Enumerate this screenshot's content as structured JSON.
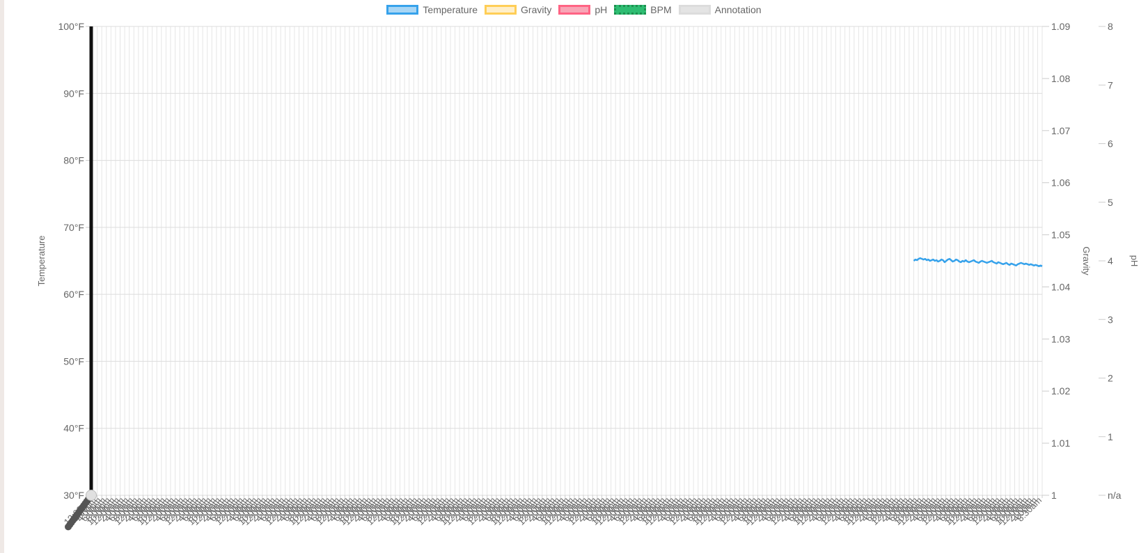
{
  "chart_data": {
    "type": "line",
    "legend": {
      "position": "top",
      "entries": [
        {
          "label": "Temperature",
          "fill": "#a8d6f5",
          "border": "#36a2eb",
          "style": "solid"
        },
        {
          "label": "Gravity",
          "fill": "#ffefc9",
          "border": "#ffce56",
          "style": "solid"
        },
        {
          "label": "pH",
          "fill": "#f8a5b6",
          "border": "#ff6384",
          "style": "solid"
        },
        {
          "label": "BPM",
          "fill": "#2ebd72",
          "border": "#1e8f50",
          "style": "dotted"
        },
        {
          "label": "Annotation",
          "fill": "#e4e4e4",
          "border": "#dcdcdc",
          "style": "solid"
        }
      ]
    },
    "axes": {
      "temperature": {
        "label": "Temperature",
        "position": "left",
        "ticks": [
          "100°F",
          "90°F",
          "80°F",
          "70°F",
          "60°F",
          "50°F",
          "40°F",
          "30°F"
        ],
        "range": [
          30,
          100
        ]
      },
      "gravity": {
        "label": "Gravity",
        "position": "right",
        "ticks": [
          "1.09",
          "1.08",
          "1.07",
          "1.06",
          "1.05",
          "1.04",
          "1.03",
          "1.02",
          "1.01",
          "1"
        ],
        "range": [
          1.0,
          1.09
        ]
      },
      "ph": {
        "label": "pH",
        "position": "right",
        "ticks": [
          "8",
          "7",
          "6",
          "5",
          "4",
          "3",
          "2",
          "1",
          "n/a"
        ],
        "range": [
          0,
          8
        ]
      }
    },
    "x_tick_count": 208,
    "x_tick_samples": [
      "12:00pm",
      "2:00pm",
      "4:00pm",
      "6:00pm",
      "8:00pm",
      "10:00pm",
      "12:00am",
      "2:00am",
      "4:00am",
      "6:00am",
      "8:00am",
      "8:30am"
    ],
    "grid": true,
    "colors": {
      "temperature": "#36a2eb",
      "annotation_line": "#111111",
      "annotation_point": "#e0e0e0",
      "cluster_points": "#555555"
    },
    "annotation": {
      "x_index": 0,
      "temperature": 30
    },
    "temperature_series": {
      "name": "Temperature",
      "start_index": 179,
      "values": [
        65.0,
        65.2,
        65.1,
        65.3,
        65.4,
        65.3,
        65.2,
        65.3,
        65.1,
        65.2,
        65.0,
        65.1,
        65.2,
        65.0,
        65.1,
        64.9,
        65.0,
        65.2,
        65.1,
        64.8,
        65.0,
        65.2,
        65.3,
        65.1,
        64.9,
        65.0,
        65.2,
        65.1,
        64.9,
        64.8,
        65.0,
        64.9,
        65.1,
        64.9,
        64.8,
        64.9,
        65.0,
        65.1,
        64.9,
        64.8,
        64.7,
        64.9,
        65.0,
        64.9,
        64.8,
        64.7,
        64.8,
        64.9,
        65.0,
        64.8,
        64.7,
        64.6,
        64.8,
        64.7,
        64.6,
        64.5,
        64.6,
        64.7,
        64.5,
        64.4,
        64.6,
        64.5,
        64.4,
        64.3,
        64.5,
        64.6,
        64.7,
        64.6,
        64.5,
        64.6,
        64.5,
        64.4,
        64.5,
        64.4,
        64.3,
        64.4,
        64.3,
        64.2,
        64.3,
        64.2
      ]
    },
    "point_cluster": [
      {
        "temperature": 30.0
      },
      {
        "temperature": 29.8
      },
      {
        "temperature": 29.6
      },
      {
        "temperature": 29.4
      },
      {
        "temperature": 29.2
      },
      {
        "temperature": 29.0
      },
      {
        "temperature": 28.8
      },
      {
        "temperature": 28.6
      },
      {
        "temperature": 28.4
      },
      {
        "temperature": 28.2
      },
      {
        "temperature": 28.0
      },
      {
        "temperature": 27.8
      },
      {
        "temperature": 27.6
      },
      {
        "temperature": 27.4
      },
      {
        "temperature": 27.2
      },
      {
        "temperature": 27.0
      }
    ]
  }
}
